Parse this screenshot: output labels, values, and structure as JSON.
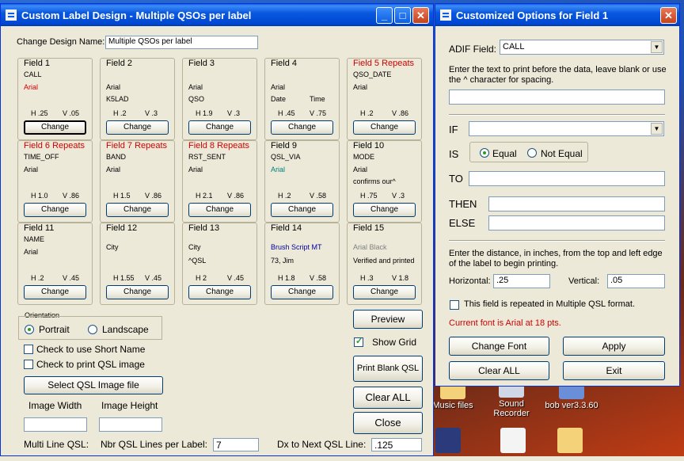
{
  "desktop": {
    "icons": [
      {
        "label": "Music files"
      },
      {
        "label": "Sound Recorder"
      },
      {
        "label": "bob ver3.3.60"
      }
    ]
  },
  "main_window": {
    "title": "Custom Label Design - Multiple QSOs per label",
    "design_name_label": "Change Design Name:",
    "design_name_value": "Multiple QSOs per label",
    "fields": [
      {
        "title": "Field 1",
        "line1": "CALL",
        "font": "Arial",
        "line3": "",
        "h": "H .25",
        "v": "V .05",
        "button": "Change"
      },
      {
        "title": "Field 2",
        "line1": "",
        "font": "Arial",
        "line3": "K5LAD",
        "h": "H .2",
        "v": "V .3",
        "button": "Change"
      },
      {
        "title": "Field 3",
        "line1": "",
        "font": "Arial",
        "line3": "QSO",
        "h": "H 1.9",
        "v": "V .3",
        "button": "Change"
      },
      {
        "title": "Field 4",
        "line1": "",
        "font": "Arial",
        "line3": "Date",
        "line3b": "Time",
        "h": "H .45",
        "v": "V .75",
        "button": "Change"
      },
      {
        "title": "Field 5 Repeats",
        "line1": "QSO_DATE",
        "font": "Arial",
        "line3": "",
        "h": "H .2",
        "v": "V .86",
        "button": "Change"
      },
      {
        "title": "Field 6 Repeats",
        "line1": "TIME_OFF",
        "font": "Arial",
        "line3": "",
        "h": "H 1.0",
        "v": "V .86",
        "button": "Change"
      },
      {
        "title": "Field 7 Repeats",
        "line1": "BAND",
        "font": "Arial",
        "line3": "",
        "h": "H 1.5",
        "v": "V .86",
        "button": "Change"
      },
      {
        "title": "Field 8 Repeats",
        "line1": "RST_SENT",
        "font": "Arial",
        "line3": "",
        "h": "H 2.1",
        "v": "V .86",
        "button": "Change"
      },
      {
        "title": "Field 9",
        "line1": "QSL_VIA",
        "font": "Arial",
        "line3": "",
        "h": "H .2",
        "v": "V .58",
        "button": "Change"
      },
      {
        "title": "Field 10",
        "line1": "MODE",
        "font": "Arial",
        "line3": "confirms our^",
        "h": "H .75",
        "v": "V .3",
        "button": "Change"
      },
      {
        "title": "Field 11",
        "line1": "NAME",
        "font": "Arial",
        "line3": "",
        "h": "H .2",
        "v": "V .45",
        "button": "Change"
      },
      {
        "title": "Field 12",
        "line1": "",
        "font": "City",
        "line3": "",
        "h": "H 1.55",
        "v": "V .45",
        "button": "Change"
      },
      {
        "title": "Field 13",
        "line1": "",
        "font": "City",
        "line3": "^QSL",
        "h": "H 2",
        "v": "V .45",
        "button": "Change"
      },
      {
        "title": "Field 14",
        "line1": "",
        "font": "Brush Script MT",
        "line3": "73, Jim",
        "h": "H 1.8",
        "v": "V .58",
        "button": "Change"
      },
      {
        "title": "Field 15",
        "line1": "",
        "font": "Arial Black",
        "line3": "Verified and printed",
        "h": "H .3",
        "v": "V 1.8",
        "button": "Change"
      }
    ],
    "orientation": {
      "label": "Orientation",
      "portrait": "Portrait",
      "landscape": "Landscape"
    },
    "check_short_name": "Check to use Short Name",
    "check_print_qsl": "Check to print QSL image",
    "select_image_button": "Select QSL Image file",
    "image_width_label": "Image Width",
    "image_height_label": "Image Height",
    "preview_button": "Preview",
    "show_grid_label": "Show Grid",
    "print_blank_button": "Print Blank QSL",
    "clear_all_button": "Clear ALL",
    "close_button": "Close",
    "multi_line_label": "Multi Line QSL:",
    "nbr_lines_label": "Nbr QSL Lines per Label:",
    "nbr_lines_value": "7",
    "dx_next_label": "Dx to Next QSL Line:",
    "dx_next_value": ".125"
  },
  "options_window": {
    "title": "Customized Options for Field 1",
    "adif_label": "ADIF Field:",
    "adif_value": "CALL",
    "enter_text_label": "Enter the text to print before the data, leave blank or use the ^ character for spacing.",
    "if_label": "IF",
    "is_label": "IS",
    "equal_label": "Equal",
    "not_equal_label": "Not Equal",
    "to_label": "TO",
    "then_label": "THEN",
    "else_label": "ELSE",
    "distance_label": "Enter the distance, in inches, from the top and left edge of the label to begin printing.",
    "horizontal_label": "Horizontal:",
    "horizontal_value": ".25",
    "vertical_label": "Vertical:",
    "vertical_value": ".05",
    "repeat_label": "This field is repeated in Multiple QSL format.",
    "current_font": "Current font is Arial at 18 pts.",
    "change_font_button": "Change Font",
    "apply_button": "Apply",
    "clear_all_button": "Clear ALL",
    "exit_button": "Exit"
  },
  "colors": {
    "title_bar": "#0a5ee8",
    "repeat_title": "#d10000",
    "window_bg": "#ece9d8"
  }
}
